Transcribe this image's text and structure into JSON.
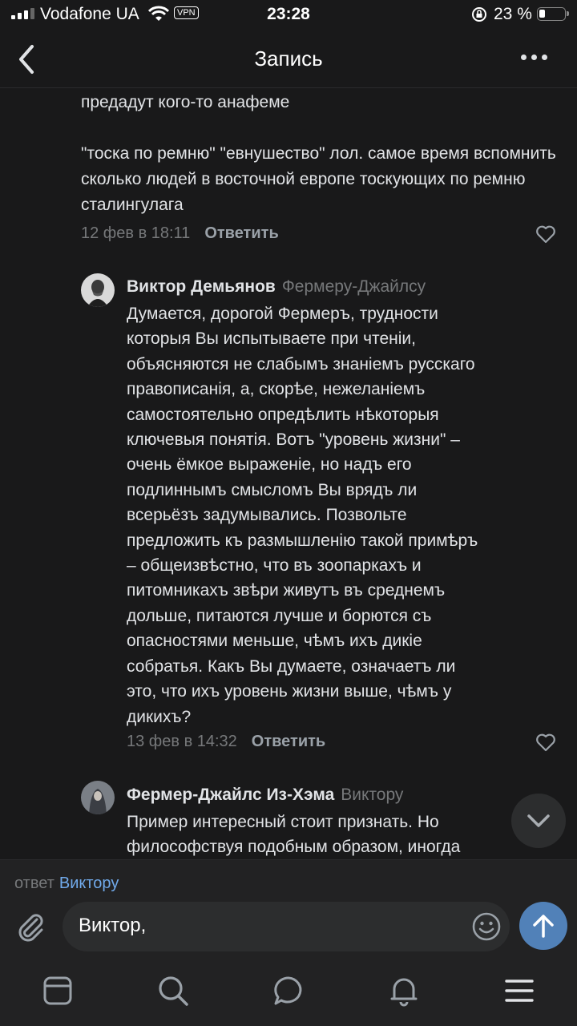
{
  "status_bar": {
    "carrier": "Vodafone UA",
    "vpn": "VPN",
    "time": "23:28",
    "battery": "23 %",
    "battery_level": 0.23
  },
  "header": {
    "title": "Запись"
  },
  "top_comment": {
    "text": "предадут кого-то анафеме\n\n\"тоска по ремню\" \"евнушество\" лол. самое время вспомнить сколько людей в восточной европе тоскующих по ремню сталингулага",
    "date": "12 фев в 18:11",
    "reply_label": "Ответить"
  },
  "comments": [
    {
      "author": "Виктор Демьянов",
      "to": "Фермеру-Джайлсу",
      "text": "Думается, дорогой Фермеръ, трудности\nкоторыя Вы испытываете при чтеніи,\nобъясняются не слабымъ знаніемъ русскаго\nправописанія, а, скорѣе, нежеланіемъ\nсамостоятельно опредѣлить нѣкоторыя\nключевыя понятія. Вотъ \"уровень жизни\" –\nочень ёмкое выраженіе, но надъ его\nподлиннымъ смысломъ Вы врядъ ли\nвсерьёзъ задумывались. Позвольте\nпредложить къ размышленію такой примѣръ\n– общеизвѣстно, что въ зоопаркахъ и\nпитомникахъ звѣри живутъ въ среднемъ\nдольше, питаются лучше и борются съ\nопасностями меньше, чѣмъ ихъ дикіе\nсобратья. Какъ Вы думаете, означаетъ ли\nэто, что ихъ уровень жизни выше, чѣмъ у\nдикихъ?",
      "date": "13 фев в 14:32",
      "reply_label": "Ответить"
    },
    {
      "author": "Фермер-Джайлс Из-Хэма",
      "to": "Виктору",
      "text": "Пример интересный стоит признать. Но\nфилософствуя подобным образом, иногда"
    }
  ],
  "reply_bar": {
    "reply_prefix": "ответ",
    "reply_to": "Виктору",
    "input_value": "Виктор,"
  },
  "icons": {
    "back": "chevron-left-icon",
    "more": "more-dots-icon",
    "like": "heart-icon",
    "attach": "paperclip-icon",
    "emoji": "smile-icon",
    "send": "arrow-up-icon",
    "scroll": "chevron-down-icon",
    "tabs": [
      "news-icon",
      "search-icon",
      "messages-icon",
      "notifications-icon",
      "menu-icon"
    ]
  },
  "colors": {
    "background": "#19191a",
    "accent": "#71aaeb",
    "send_button": "#5181b8",
    "secondary_text": "#76787a"
  }
}
